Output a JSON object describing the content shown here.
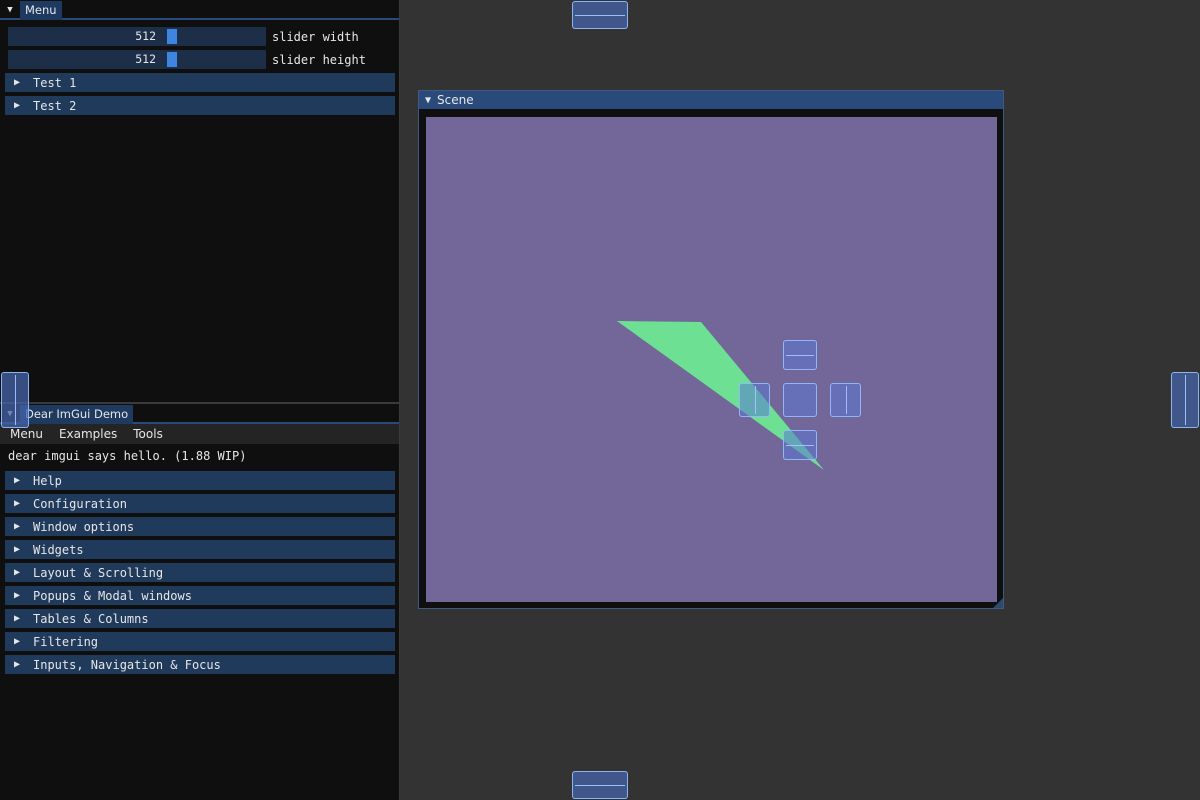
{
  "menu_window": {
    "tab_label": "Menu",
    "sliders": [
      {
        "value": "512",
        "label": "slider width",
        "fraction": 0.5
      },
      {
        "value": "512",
        "label": "slider height",
        "fraction": 0.5
      }
    ],
    "headers": [
      {
        "label": "Test 1"
      },
      {
        "label": "Test 2"
      }
    ]
  },
  "demo_window": {
    "tab_label": "Dear ImGui Demo",
    "menubar": [
      "Menu",
      "Examples",
      "Tools"
    ],
    "hello_text": "dear imgui says hello. (1.88 WIP)",
    "headers": [
      {
        "label": "Help"
      },
      {
        "label": "Configuration"
      },
      {
        "label": "Window options"
      },
      {
        "label": "Widgets"
      },
      {
        "label": "Layout & Scrolling"
      },
      {
        "label": "Popups & Modal windows"
      },
      {
        "label": "Tables & Columns"
      },
      {
        "label": "Filtering"
      },
      {
        "label": "Inputs, Navigation & Focus"
      }
    ]
  },
  "scene_window": {
    "title": "Scene",
    "background_color": "#73679a",
    "triangle_color": "#6ee094"
  },
  "colors": {
    "header": "#203a5c",
    "accent": "#3d85e0",
    "title_active": "#294a7a"
  }
}
